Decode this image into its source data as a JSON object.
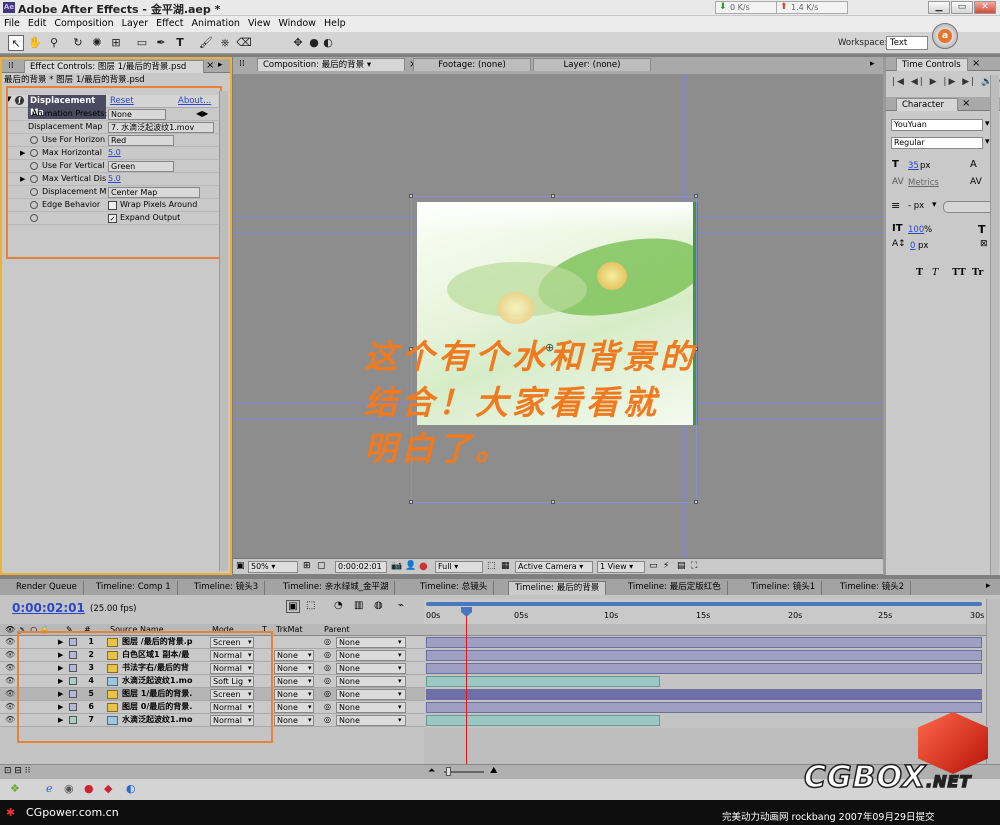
{
  "app": {
    "title": "Adobe After Effects - 金平湖.aep *",
    "net_down": "0 K/s",
    "net_up": "1.4 K/s",
    "menu": [
      "File",
      "Edit",
      "Composition",
      "Layer",
      "Effect",
      "Animation",
      "View",
      "Window",
      "Help"
    ],
    "workspace_label": "Workspace:",
    "workspace_value": "Text"
  },
  "effect_controls": {
    "tab_label": "Effect Controls: 图层 1/最后的背景.psd",
    "breadcrumb": "最后的背景 * 图层 1/最后的背景.psd",
    "effect_name": "Displacement Ma",
    "reset": "Reset",
    "about": "About...",
    "rows": [
      {
        "label": "Animation Presets:",
        "value": "None"
      },
      {
        "label": "Displacement Map",
        "value": "7. 水滴泛起波纹1.mov"
      },
      {
        "label": "Use For Horizon",
        "value": "Red"
      },
      {
        "label": "Max Horizontal",
        "value": "5.0"
      },
      {
        "label": "Use For Vertical",
        "value": "Green"
      },
      {
        "label": "Max Vertical Dis",
        "value": "5.0"
      },
      {
        "label": "Displacement M",
        "value": "Center Map"
      },
      {
        "label": "Edge Behavior",
        "value": "Wrap Pixels Around"
      },
      {
        "label": "",
        "value": "Expand Output"
      }
    ]
  },
  "viewer": {
    "tabs": [
      "Composition: 最后的背景",
      "Footage: (none)",
      "Layer: (none)"
    ],
    "overlay_lines": [
      "这个有个水和背景的",
      "结合！大家看看就",
      "明白了。"
    ],
    "zoom": "50%",
    "timecode": "0:00:02:01",
    "resolution": "Full",
    "camera": "Active Camera",
    "views": "1 View"
  },
  "right_panel": {
    "time_controls": "Time Controls",
    "character": "Character",
    "font": "YouYuan",
    "style": "Regular",
    "size": "35",
    "size_unit": "px",
    "kerning": "Metrics",
    "leading_unit": "- px",
    "vscale": "100",
    "vscale_unit": "%",
    "baseline": "0",
    "baseline_unit": "px",
    "style_buttons": [
      "T",
      "T",
      "TT",
      "Tr"
    ]
  },
  "timeline": {
    "tabs": [
      "Render Queue",
      "Timeline: Comp 1",
      "Timeline: 镜头3",
      "Timeline: 亲水绿城_金平湖",
      "Timeline: 总镜头",
      "Timeline: 最后的背景",
      "Timeline: 最后定版红色",
      "Timeline: 镜头1",
      "Timeline: 镜头2"
    ],
    "timecode": "0:00:02:01",
    "fps": "(25.00 fps)",
    "headers": {
      "num": "#",
      "source": "Source Name",
      "mode": "Mode",
      "t": "T",
      "trkmat": "TrkMat",
      "parent": "Parent"
    },
    "ruler": [
      "00s",
      "05s",
      "10s",
      "15s",
      "20s",
      "25s",
      "30s"
    ],
    "layers": [
      {
        "num": "1",
        "name": "图层 /最后的背景.p",
        "mode": "Screen",
        "trkmat": "",
        "parent": "None",
        "type": "psd",
        "bar": "purple",
        "bar_end": 1.0
      },
      {
        "num": "2",
        "name": "白色区域1 副本/最",
        "mode": "Normal",
        "trkmat": "None",
        "parent": "None",
        "type": "psd",
        "bar": "purple",
        "bar_end": 1.0
      },
      {
        "num": "3",
        "name": "书法字右/最后的背",
        "mode": "Normal",
        "trkmat": "None",
        "parent": "None",
        "type": "psd",
        "bar": "purple",
        "bar_end": 1.0
      },
      {
        "num": "4",
        "name": "水滴泛起波纹1.mo",
        "mode": "Soft Lig",
        "trkmat": "None",
        "parent": "None",
        "type": "mov",
        "bar": "teal",
        "bar_end": 0.42
      },
      {
        "num": "5",
        "name": "图层 1/最后的背景.",
        "mode": "Screen",
        "trkmat": "None",
        "parent": "None",
        "type": "psd",
        "bar": "purple-sel",
        "bar_end": 1.0
      },
      {
        "num": "6",
        "name": "图层 0/最后的背景.",
        "mode": "Normal",
        "trkmat": "None",
        "parent": "None",
        "type": "psd",
        "bar": "purple",
        "bar_end": 1.0
      },
      {
        "num": "7",
        "name": "水滴泛起波纹1.mo",
        "mode": "Normal",
        "trkmat": "None",
        "parent": "None",
        "type": "mov",
        "bar": "teal",
        "bar_end": 0.42
      }
    ]
  },
  "watermark": {
    "brand": "CGBOX",
    "brand_suffix": ".NET",
    "site": "CGpower.com.cn",
    "credit": "完美动力动画网 rockbang 2007年09月29日提交"
  },
  "colors": {
    "accent_orange": "#f07a1d",
    "highlight_box": "#e8823a",
    "panel_focus": "#f0b030",
    "playhead": "#e01515",
    "link_blue": "#2a48c9"
  }
}
